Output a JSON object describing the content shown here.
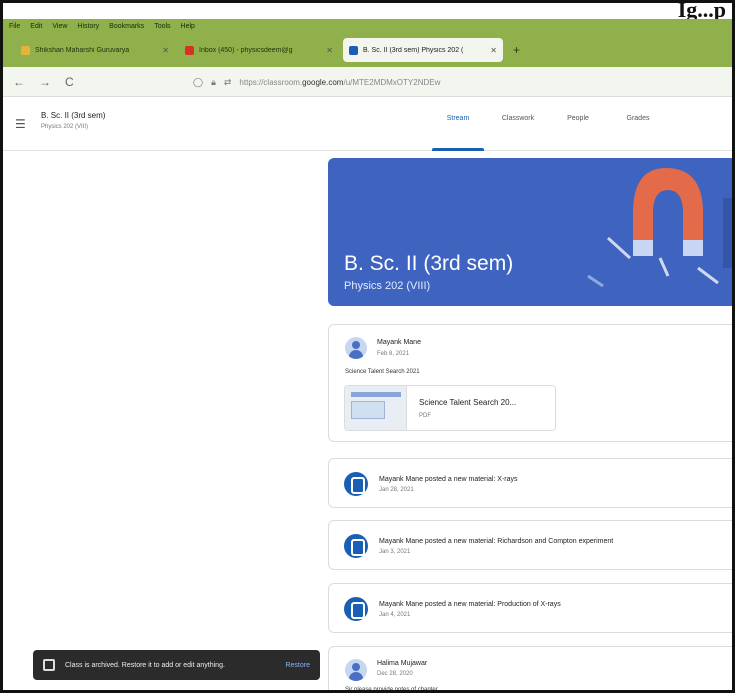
{
  "heading_fragment": "Ig...p",
  "menu": [
    "File",
    "Edit",
    "View",
    "History",
    "Bookmarks",
    "Tools",
    "Help"
  ],
  "tabs": [
    {
      "label": "Shikshan Maharshi Guruvarya",
      "color": "#e6b33a"
    },
    {
      "label": "Inbox (450) - physicsdeem@g",
      "color": "#d93025"
    },
    {
      "label": "B. Sc. II (3rd sem) Physics 202 (",
      "color": "#1a5fb4"
    }
  ],
  "new_tab": "+",
  "nav": {
    "back": "←",
    "forward": "→",
    "reload": "C"
  },
  "url": {
    "prefix": "https://classroom.",
    "host": "google.com",
    "path": "/u/MTE2MDMxOTY2NDEw"
  },
  "classroom": {
    "title": "B. Sc. II (3rd sem)",
    "subtitle": "Physics 202 (VIII)",
    "tabs": [
      "Stream",
      "Classwork",
      "People",
      "Grades"
    ]
  },
  "banner": {
    "title": "B. Sc. II (3rd sem)",
    "subtitle": "Physics 202 (VIII)"
  },
  "posts": {
    "first": {
      "author": "Mayank Mane",
      "date": "Feb 8, 2021",
      "body": "Science Talent Search 2021",
      "attachment": {
        "name": "Science Talent Search 20...",
        "type": "PDF"
      }
    },
    "materials": [
      {
        "title": "Mayank Mane posted a new material: X-rays",
        "date": "Jan 28, 2021"
      },
      {
        "title": "Mayank Mane posted a new material: Richardson and Compton experiment",
        "date": "Jan 3, 2021"
      },
      {
        "title": "Mayank Mane posted a new material: Production of X-rays",
        "date": "Jan 4, 2021"
      }
    ],
    "last": {
      "author": "Halima Mujawar",
      "date": "Dec 28, 2020",
      "body": "Sir please provide notes of chapter..."
    }
  },
  "snackbar": {
    "message": "Class is archived. Restore it to add or edit anything.",
    "action": "Restore"
  },
  "colors": {
    "browser_chrome": "#8fb04a",
    "banner": "#3e64c0",
    "accent": "#1a5fb4"
  }
}
